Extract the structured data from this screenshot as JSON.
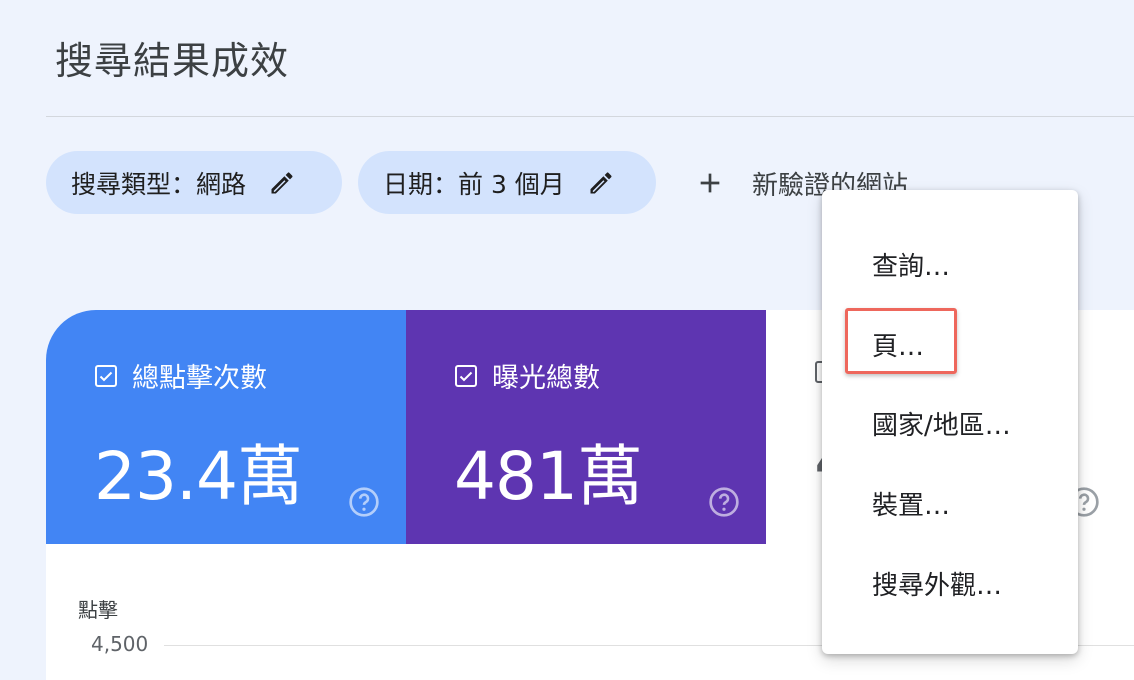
{
  "header": {
    "title": "搜尋結果成效"
  },
  "filters": {
    "search_type": "搜尋類型：網路",
    "date": "日期：前 3 個月",
    "add_label": "新驗證的網站"
  },
  "metrics": {
    "clicks": {
      "label": "總點擊次數",
      "value": "23.4萬",
      "checked": true,
      "color": "#4285f4"
    },
    "impressions": {
      "label": "曝光總數",
      "value": "481萬",
      "checked": true,
      "color": "#5e35b1"
    },
    "ctr": {
      "value_partial": "4"
    }
  },
  "chart": {
    "y_axis_title": "點擊",
    "y_tick_top": "4,500"
  },
  "menu": {
    "items": [
      "查詢…",
      "頁…",
      "國家/地區…",
      "裝置…",
      "搜尋外觀…"
    ],
    "highlighted": "頁…"
  }
}
